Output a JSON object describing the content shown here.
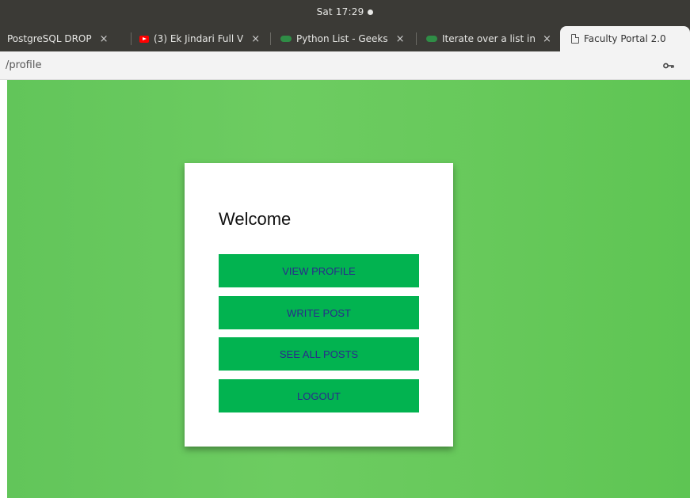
{
  "system": {
    "clock": "Sat 17:29"
  },
  "tabs": [
    {
      "title": "PostgreSQL DROP",
      "favicon": "none",
      "active": false
    },
    {
      "title": "(3) Ek Jindari Full V",
      "favicon": "youtube-icon",
      "active": false
    },
    {
      "title": "Python List - Geeks",
      "favicon": "geeksforgeeks-icon",
      "active": false
    },
    {
      "title": "Iterate over a list in",
      "favicon": "geeksforgeeks-icon",
      "active": false
    },
    {
      "title": "Faculty Portal 2.0",
      "favicon": "document-icon",
      "active": true
    }
  ],
  "tab_close": "×",
  "address": {
    "url": "/profile"
  },
  "card": {
    "heading": "Welcome",
    "buttons": [
      {
        "label": "VIEW PROFILE"
      },
      {
        "label": "WRITE POST"
      },
      {
        "label": "SEE ALL POSTS"
      },
      {
        "label": "LOGOUT"
      }
    ]
  },
  "colors": {
    "accent_button": "#02b350",
    "button_text": "#2a2a8c",
    "page_background": "#67c95b"
  }
}
